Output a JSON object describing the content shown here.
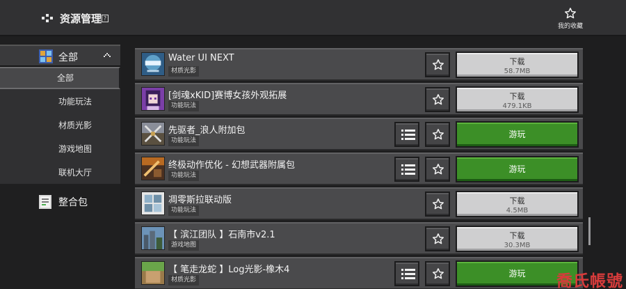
{
  "header": {
    "title": "资源管理",
    "help_label": "?",
    "favorites_label": "我的收藏"
  },
  "sidebar": {
    "category": {
      "label": "全部"
    },
    "sub_items": [
      {
        "label": "全部",
        "active": true
      },
      {
        "label": "功能玩法",
        "active": false
      },
      {
        "label": "材质光影",
        "active": false
      },
      {
        "label": "游戏地图",
        "active": false
      },
      {
        "label": "联机大厅",
        "active": false
      }
    ],
    "modpack": {
      "label": "整合包"
    }
  },
  "resources": [
    {
      "title": "Water UI NEXT",
      "tag": "材质光影",
      "action": "download",
      "action_label": "下载",
      "size": "58.7MB",
      "has_menu": false,
      "thumb_icon": "water-logo",
      "thumb_colors": [
        "#5fa0c8",
        "#2f5d86"
      ]
    },
    {
      "title": "[剑魂xKID]赛博女孩外观拓展",
      "tag": "功能玩法",
      "action": "download",
      "action_label": "下载",
      "size": "479.1KB",
      "has_menu": false,
      "thumb_icon": "anime-girl",
      "thumb_colors": [
        "#7b3fa8",
        "#d8b9e8"
      ]
    },
    {
      "title": "先驱者_浪人附加包",
      "tag": "功能玩法",
      "action": "play",
      "action_label": "游玩",
      "size": "",
      "has_menu": true,
      "thumb_icon": "crossed-swords",
      "thumb_colors": [
        "#8a8e99",
        "#5a5040"
      ]
    },
    {
      "title": "终极动作优化 - 幻想武器附属包",
      "tag": "功能玩法",
      "action": "play",
      "action_label": "游玩",
      "size": "",
      "has_menu": true,
      "thumb_icon": "fantasy-weapons",
      "thumb_colors": [
        "#b86a22",
        "#4a3020"
      ]
    },
    {
      "title": "凋零斯拉联动版",
      "tag": "功能玩法",
      "action": "download",
      "action_label": "下载",
      "size": "4.5MB",
      "has_menu": false,
      "thumb_icon": "blocks",
      "thumb_colors": [
        "#8fb0c8",
        "#e6e6e6"
      ]
    },
    {
      "title": "【 滨江团队 】石南市v2.1",
      "tag": "游戏地图",
      "action": "download",
      "action_label": "下载",
      "size": "30.3MB",
      "has_menu": false,
      "thumb_icon": "city",
      "thumb_colors": [
        "#6c93b8",
        "#3d5b3a"
      ]
    },
    {
      "title": "【 笔走龙蛇 】Log光影-橡木4",
      "tag": "材质光影",
      "action": "play",
      "action_label": "游玩",
      "size": "",
      "has_menu": true,
      "thumb_icon": "log",
      "thumb_colors": [
        "#6aa54a",
        "#9a7a4a"
      ]
    }
  ],
  "watermark": "喬氏帳號",
  "colors": {
    "play_green": "#3c8f27",
    "download_gray": "#cfcfd0",
    "row_bg": "#4a4a4c",
    "sidebar_active": "#48484a"
  }
}
